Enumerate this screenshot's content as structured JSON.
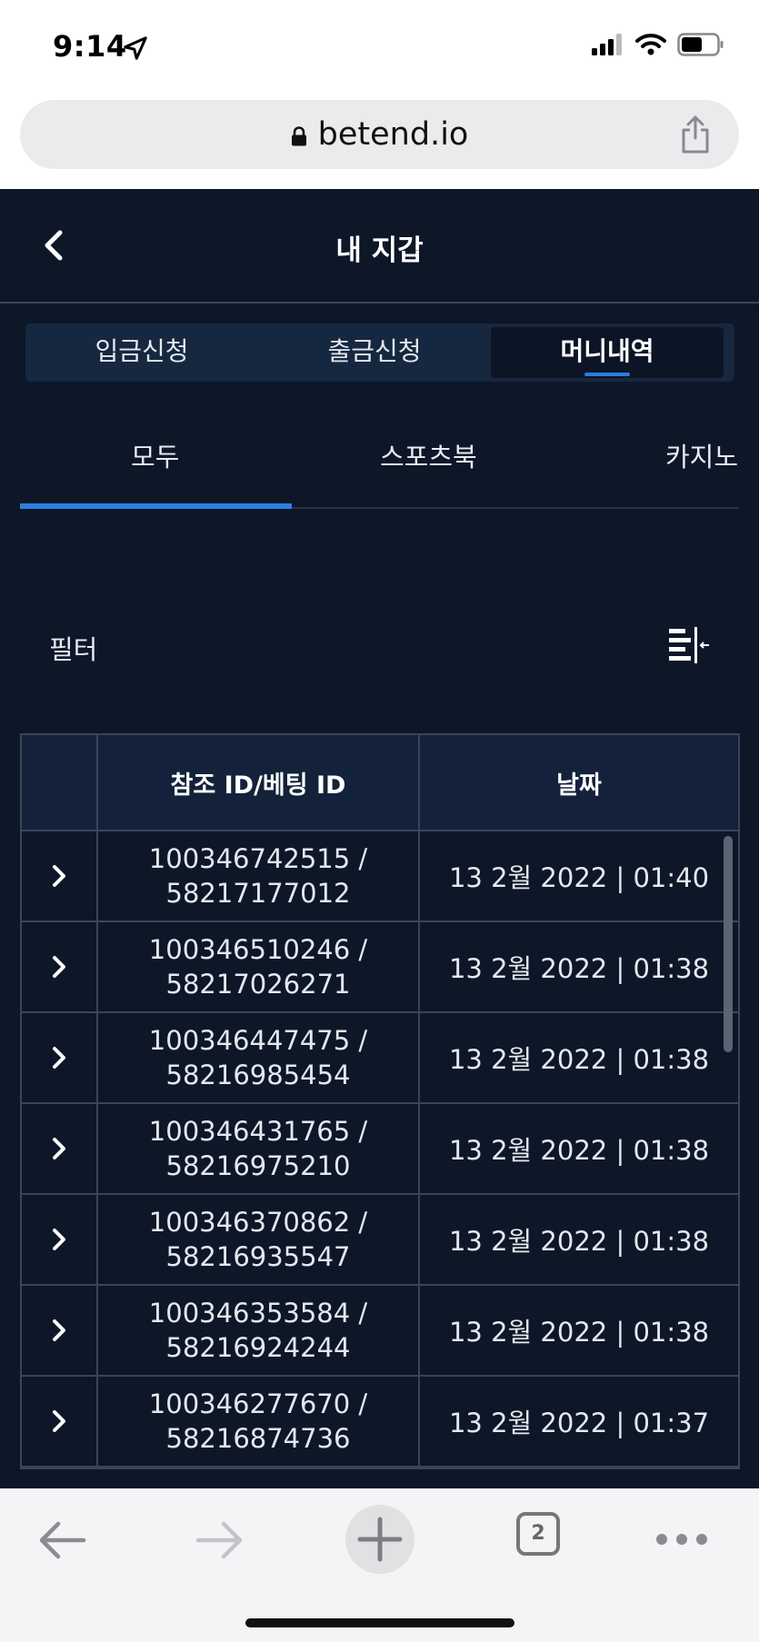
{
  "status_bar": {
    "time": "9:14"
  },
  "browser": {
    "url": "betend.io",
    "tab_count": "2"
  },
  "header": {
    "title": "내 지갑"
  },
  "segments": [
    {
      "label": "입금신청"
    },
    {
      "label": "출금신청"
    },
    {
      "label": "머니내역",
      "active": true
    }
  ],
  "categories": [
    {
      "label": "모두",
      "active": true
    },
    {
      "label": "스포츠북"
    },
    {
      "label": "카지노"
    }
  ],
  "filter": {
    "label": "필터"
  },
  "table": {
    "headers": [
      "",
      "참조 ID/베팅 ID",
      "날짜"
    ],
    "rows": [
      {
        "ref_id": "100346742515 /",
        "bet_id": "58217177012",
        "date": "13 2월 2022 | 01:40"
      },
      {
        "ref_id": "100346510246 /",
        "bet_id": "58217026271",
        "date": "13 2월 2022 | 01:38"
      },
      {
        "ref_id": "100346447475 /",
        "bet_id": "58216985454",
        "date": "13 2월 2022 | 01:38"
      },
      {
        "ref_id": "100346431765 /",
        "bet_id": "58216975210",
        "date": "13 2월 2022 | 01:38"
      },
      {
        "ref_id": "100346370862 /",
        "bet_id": "58216935547",
        "date": "13 2월 2022 | 01:38"
      },
      {
        "ref_id": "100346353584 /",
        "bet_id": "58216924244",
        "date": "13 2월 2022 | 01:38"
      },
      {
        "ref_id": "100346277670 /",
        "bet_id": "58216874736",
        "date": "13 2월 2022 | 01:37"
      }
    ]
  },
  "colors": {
    "app_bg": "#0d1728",
    "accent": "#2e7fe4",
    "header_row_bg": "#13223a"
  }
}
